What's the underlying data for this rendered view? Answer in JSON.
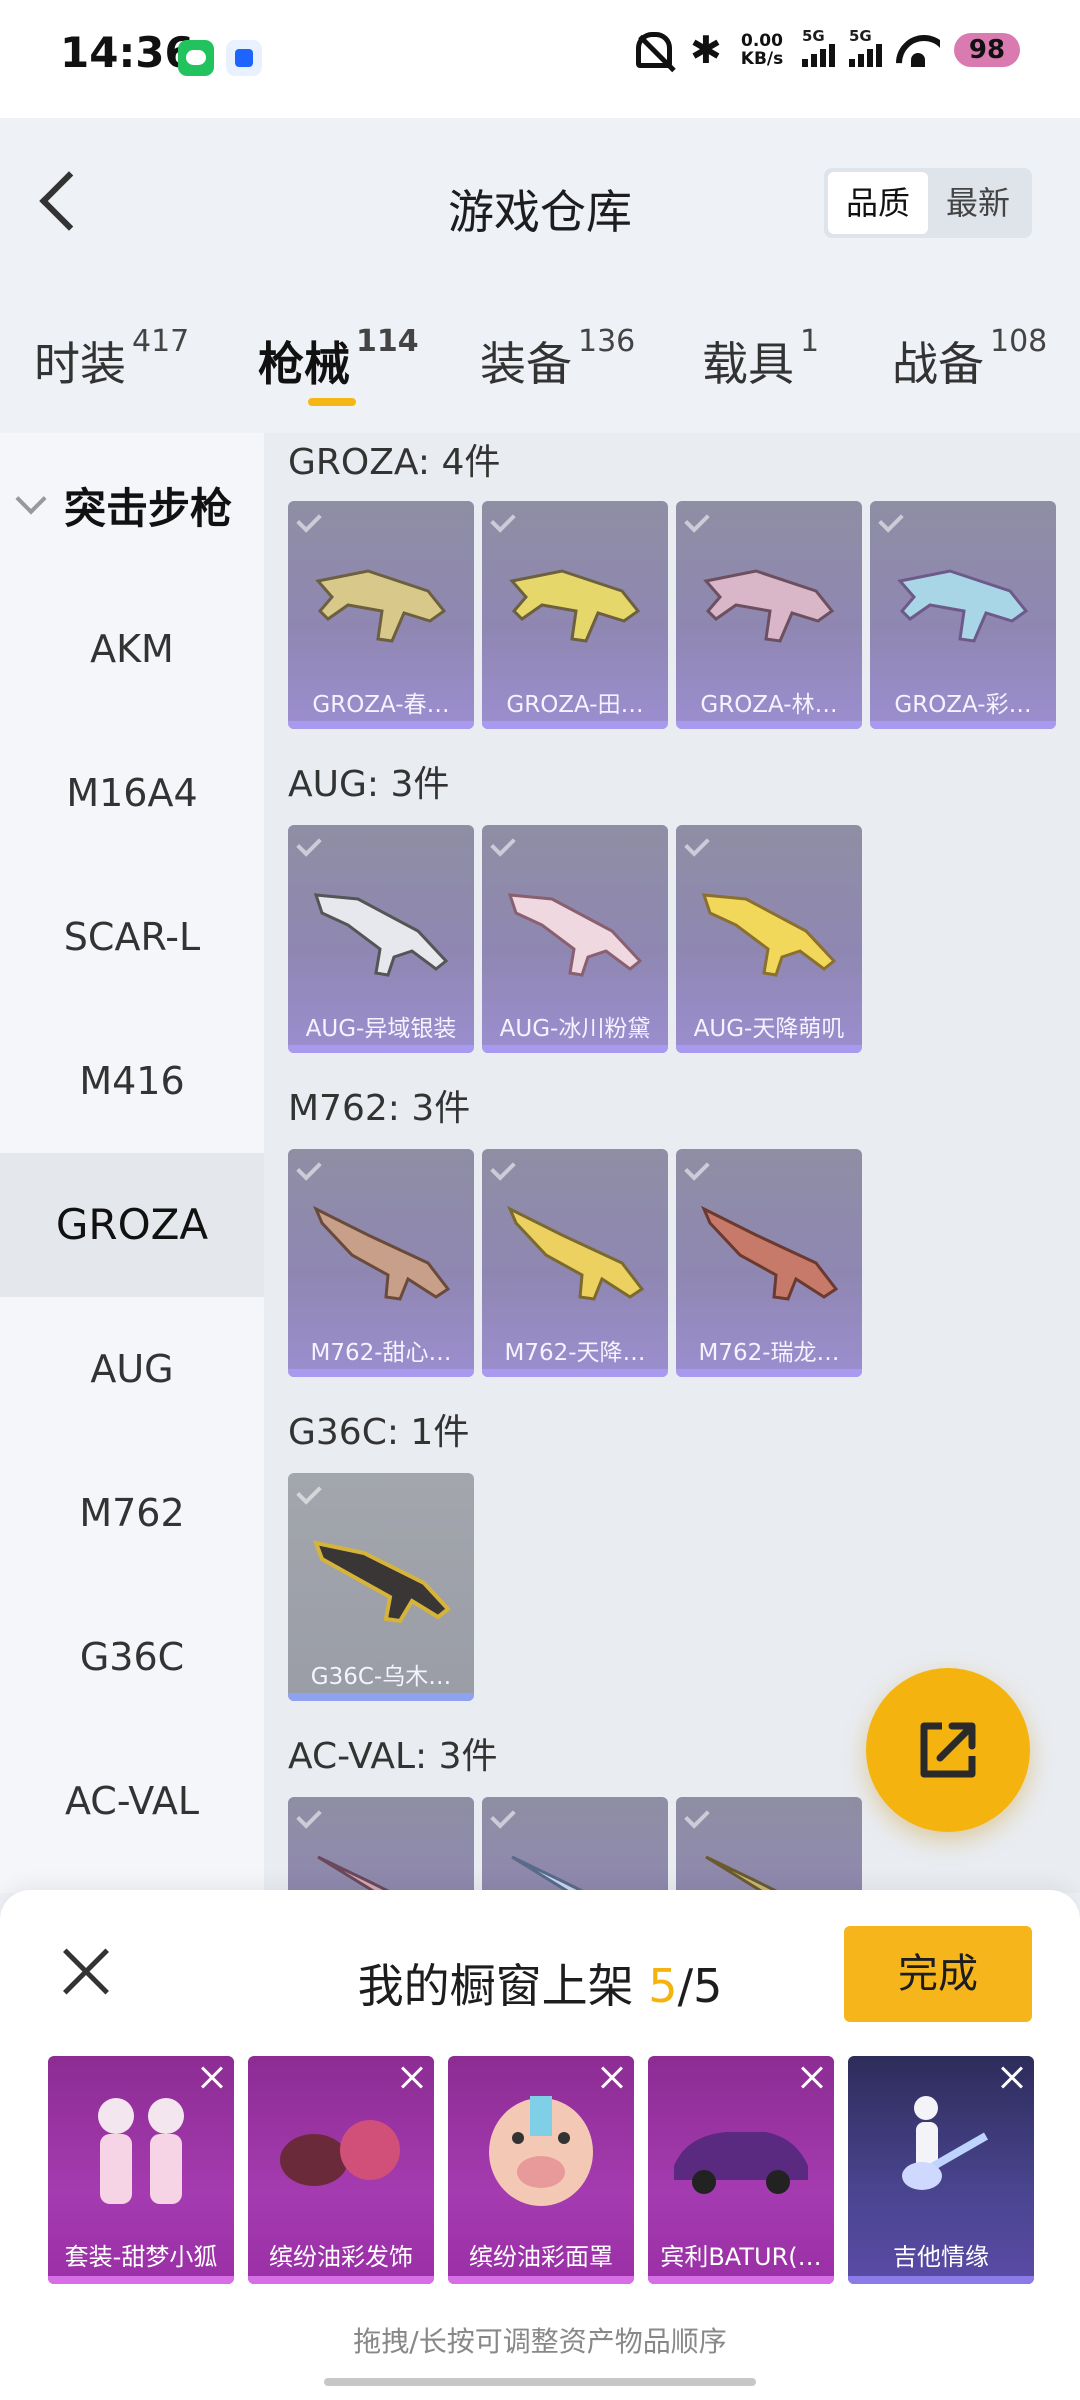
{
  "status_bar": {
    "time": "14:36",
    "net_speed": "0.00\nKB/s",
    "net_speed_value": "0.00",
    "net_speed_unit": "KB/s",
    "signal1_label": "5G",
    "signal2_label": "5G",
    "battery": "98",
    "icons": [
      "wechat-icon",
      "app-icon",
      "mute-bell-icon",
      "bluetooth-icon",
      "signal-icon",
      "wifi-icon",
      "battery-icon"
    ]
  },
  "header": {
    "title": "游戏仓库",
    "sort_options": [
      "品质",
      "最新"
    ],
    "active_sort": "品质"
  },
  "tabs": [
    {
      "label": "时装",
      "count": "417"
    },
    {
      "label": "枪械",
      "count": "114"
    },
    {
      "label": "装备",
      "count": "136"
    },
    {
      "label": "载具",
      "count": "1"
    },
    {
      "label": "战备",
      "count": "108"
    }
  ],
  "active_tab": "枪械",
  "sidebar": {
    "group": "突击步枪",
    "items": [
      "AKM",
      "M16A4",
      "SCAR-L",
      "M416",
      "GROZA",
      "AUG",
      "M762",
      "G36C",
      "AC-VAL"
    ],
    "active": "GROZA"
  },
  "groups": [
    {
      "title": "GROZA: 4件",
      "items": [
        "GROZA-春…",
        "GROZA-田…",
        "GROZA-林…",
        "GROZA-彩…"
      ]
    },
    {
      "title": "AUG: 3件",
      "items": [
        "AUG-异域银装",
        "AUG-冰川粉黛",
        "AUG-天降萌叽"
      ]
    },
    {
      "title": "M762: 3件",
      "items": [
        "M762-甜心…",
        "M762-天降…",
        "M762-瑞龙…"
      ]
    },
    {
      "title": "G36C: 1件",
      "items": [
        "G36C-乌木…"
      ]
    },
    {
      "title": "AC-VAL: 3件",
      "items": [
        "",
        "",
        ""
      ]
    }
  ],
  "panel": {
    "title_prefix": "我的橱窗上架",
    "current": "5",
    "separator": "/",
    "total": "5",
    "done_label": "完成",
    "items": [
      "套装-甜梦小狐",
      "缤纷油彩发饰",
      "缤纷油彩面罩",
      "宾利BATUR(…",
      "吉他情缘"
    ],
    "hint": "拖拽/长按可调整资产物品顺序"
  },
  "colors": {
    "accent": "#f5b30f",
    "card_purple": "#9c8ed0",
    "shelf_magenta": "#a53bb0"
  }
}
